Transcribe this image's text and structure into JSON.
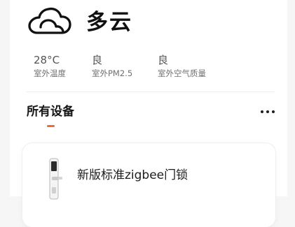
{
  "weather": {
    "icon": "cloud-icon",
    "condition": "多云"
  },
  "stats": [
    {
      "value": "28°C",
      "label": "室外温度"
    },
    {
      "value": "良",
      "label": "室外PM2.5"
    },
    {
      "value": "良",
      "label": "室外空气质量"
    }
  ],
  "devices_section": {
    "title": "所有设备",
    "more_icon": "more-dots-icon",
    "accent_color": "#f06b2f"
  },
  "devices": [
    {
      "name": "新版标准zigbee门锁",
      "icon": "door-lock-icon"
    }
  ]
}
